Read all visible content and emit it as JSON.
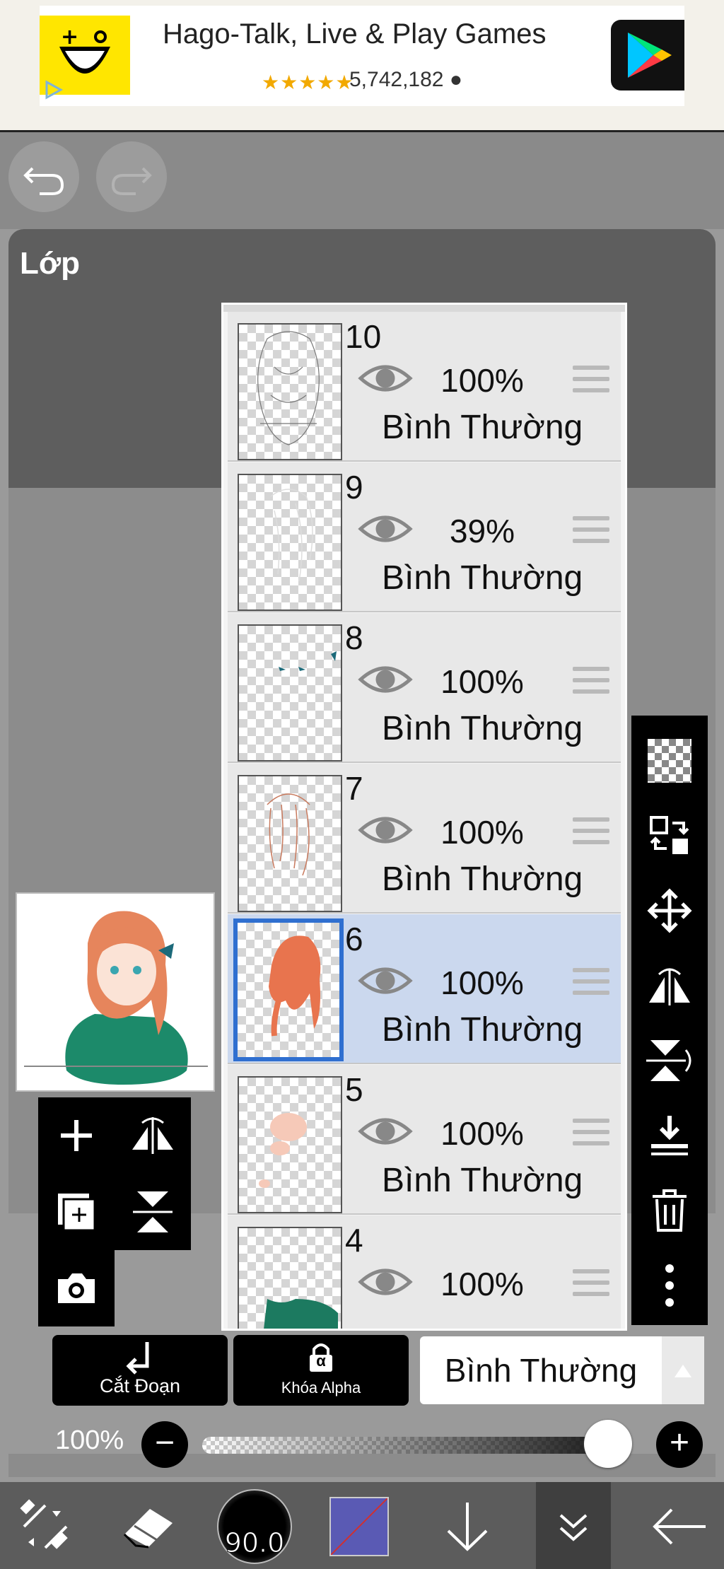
{
  "ad": {
    "title": "Hago-Talk, Live & Play Games",
    "stars": "★★★★★",
    "reviews": "5,742,182",
    "brand_color": "#ffe600"
  },
  "layers_panel": {
    "title": "Lớp"
  },
  "layers": [
    {
      "name": "10",
      "opacity": "100%",
      "blend": "Bình Thường",
      "visible": true,
      "selected": false
    },
    {
      "name": "9",
      "opacity": "39%",
      "blend": "Bình Thường",
      "visible": true,
      "selected": false
    },
    {
      "name": "8",
      "opacity": "100%",
      "blend": "Bình Thường",
      "visible": true,
      "selected": false
    },
    {
      "name": "7",
      "opacity": "100%",
      "blend": "Bình Thường",
      "visible": true,
      "selected": false
    },
    {
      "name": "6",
      "opacity": "100%",
      "blend": "Bình Thường",
      "visible": true,
      "selected": true
    },
    {
      "name": "5",
      "opacity": "100%",
      "blend": "Bình Thường",
      "visible": true,
      "selected": false
    },
    {
      "name": "4",
      "opacity": "100%",
      "blend": "",
      "visible": true,
      "selected": false
    }
  ],
  "controls": {
    "cut_label": "Cắt Đoạn",
    "alpha_label": "Khóa Alpha",
    "alpha_symbol": "α",
    "blend_mode": "Bình Thường",
    "opacity_label": "100%",
    "opacity_value": 1.0,
    "minus": "−",
    "plus": "+"
  },
  "toolbar": {
    "brush_size": "90.0",
    "color": "#5a5ab4"
  },
  "colors": {
    "selected_border": "#2f6fd0",
    "selected_bg": "#cbd8ee"
  }
}
